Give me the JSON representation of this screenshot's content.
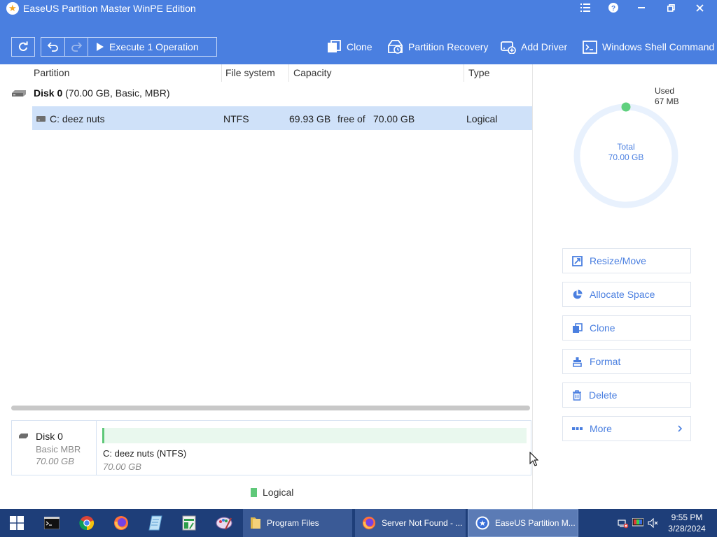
{
  "window": {
    "title": "EaseUS Partition Master WinPE Edition"
  },
  "toolbar": {
    "execute_label": "Execute 1 Operation",
    "actions": [
      {
        "label": "Clone",
        "icon": "clone-icon"
      },
      {
        "label": "Partition Recovery",
        "icon": "partition-recovery-icon"
      },
      {
        "label": "Add Driver",
        "icon": "add-driver-icon"
      },
      {
        "label": "Windows Shell Command",
        "icon": "shell-command-icon"
      }
    ]
  },
  "table": {
    "columns": [
      "Partition",
      "File system",
      "Capacity",
      "Type"
    ],
    "disk": {
      "name": "Disk 0",
      "info": "(70.00 GB, Basic, MBR)"
    },
    "rows": [
      {
        "partition": "C: deez nuts",
        "file_system": "NTFS",
        "free": "69.93 GB",
        "free_of": "free of",
        "total": "70.00 GB",
        "type": "Logical"
      }
    ]
  },
  "disk_map": {
    "name": "Disk 0",
    "type": "Basic MBR",
    "size": "70.00 GB",
    "partition_label": "C: deez nuts (NTFS)",
    "partition_size": "70.00 GB",
    "used_fraction": 0.001,
    "legend": "Logical"
  },
  "usage": {
    "used_label": "Used",
    "used_value": "67 MB",
    "total_label": "Total",
    "total_value": "70.00 GB"
  },
  "operations": [
    {
      "label": "Resize/Move",
      "icon": "resize-move-icon"
    },
    {
      "label": "Allocate Space",
      "icon": "allocate-space-icon"
    },
    {
      "label": "Clone",
      "icon": "clone-icon"
    },
    {
      "label": "Format",
      "icon": "format-icon"
    },
    {
      "label": "Delete",
      "icon": "trash-icon"
    },
    {
      "label": "More",
      "icon": "more-icon"
    }
  ],
  "taskbar": {
    "items": [
      {
        "label": "Program Files",
        "icon": "folder-icon"
      },
      {
        "label": "Server Not Found - ...",
        "icon": "firefox-icon"
      },
      {
        "label": "EaseUS Partition M...",
        "icon": "easeus-icon"
      }
    ],
    "time": "9:55 PM",
    "date": "3/28/2024"
  },
  "colors": {
    "accent": "#4a7fe0",
    "selected_row": "#cfe1f9",
    "logical": "#5fc879",
    "taskbar": "#1e3e79"
  }
}
